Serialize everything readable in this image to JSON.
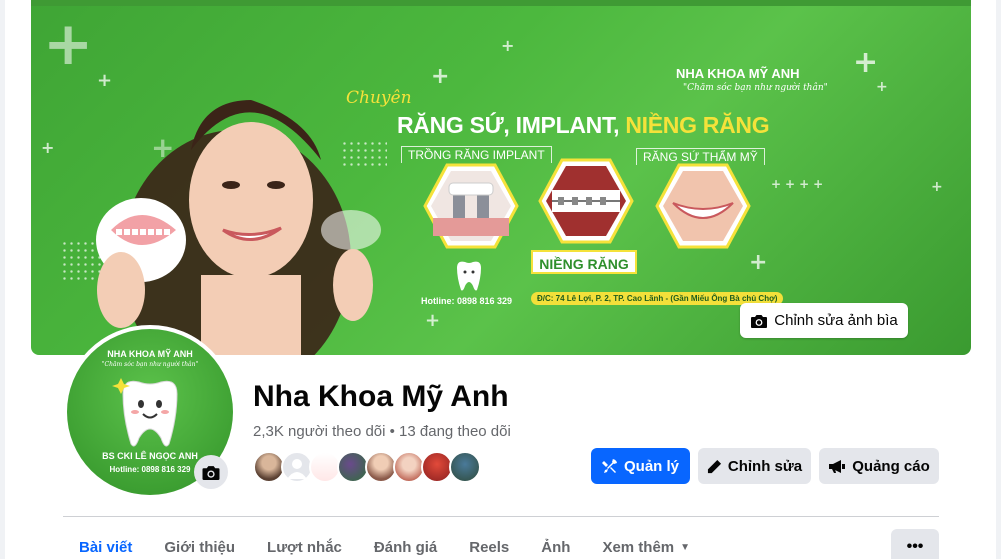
{
  "cover": {
    "headline_script": "Chuyên",
    "headline_part1": "RĂNG SỨ, IMPLANT, ",
    "headline_part2": "NIỀNG RĂNG",
    "brand_title": "NHA KHOA MỸ ANH",
    "brand_subtitle": "\"Chăm sóc bạn như người thân\"",
    "service_1": "TRỒNG RĂNG IMPLANT",
    "service_2": "RĂNG SỨ THẨM MỸ",
    "service_3": "NIỀNG RĂNG",
    "hotline": "Hotline: 0898 816 329",
    "address": "Đ/C: 74 Lê Lợi, P. 2, TP. Cao Lãnh - (Gần Miếu Ông Bà chủ Chợ)",
    "edit_cover_label": "Chỉnh sửa ảnh bìa"
  },
  "avatar": {
    "title": "NHA KHOA MỸ ANH",
    "subtitle": "\"Chăm sóc bạn như người thân\"",
    "doctor": "BS CKI LÊ NGỌC ANH",
    "hotline": "Hotline: 0898 816 329"
  },
  "profile": {
    "name": "Nha Khoa Mỹ Anh",
    "followers": "2,3K người theo dõi • 13 đang theo dõi"
  },
  "actions": {
    "manage": "Quản lý",
    "edit": "Chỉnh sửa",
    "ads": "Quảng cáo"
  },
  "tabs": [
    "Bài viết",
    "Giới thiệu",
    "Lượt nhắc",
    "Đánh giá",
    "Reels",
    "Ảnh",
    "Xem thêm"
  ],
  "colors": {
    "primary": "#0866ff",
    "cover_green": "#4cb83e",
    "accent_yellow": "#f5e23a"
  }
}
